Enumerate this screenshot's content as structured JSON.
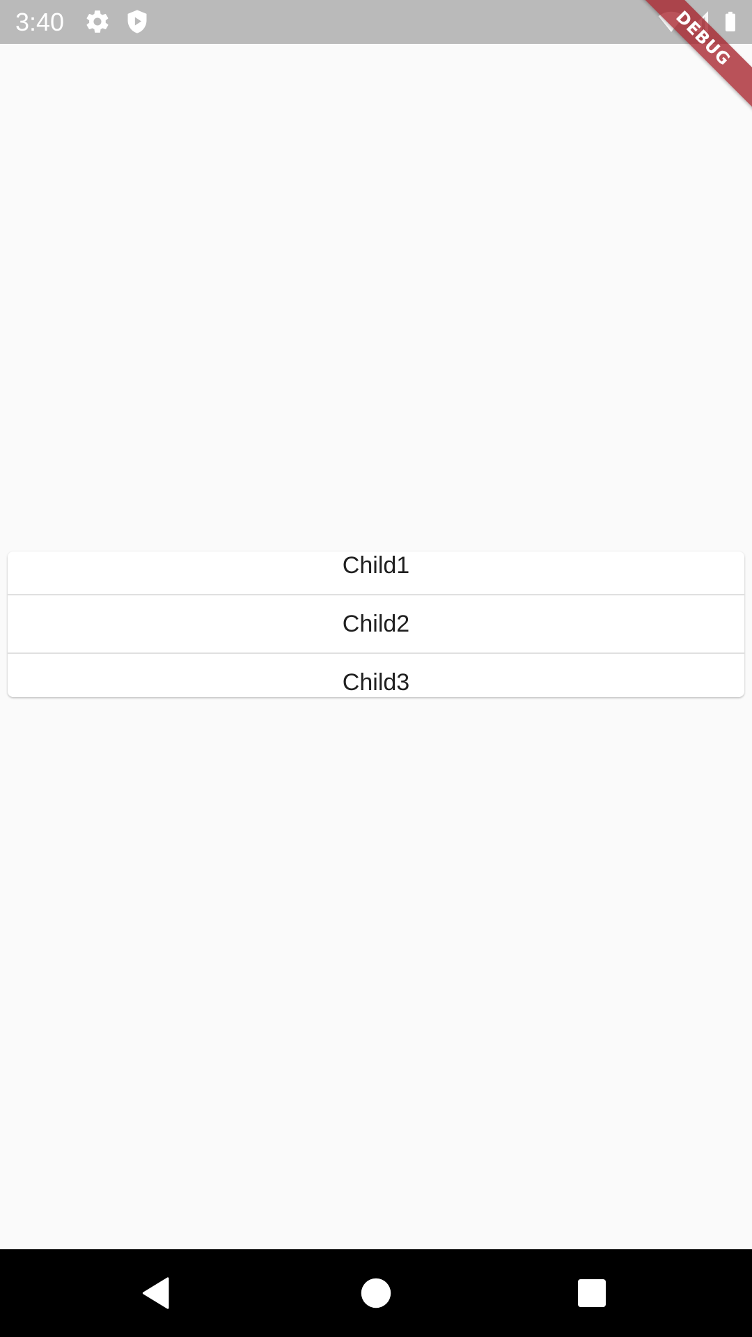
{
  "status_bar": {
    "time": "3:40",
    "icons": [
      "gear-icon",
      "shield-play-icon",
      "wifi-icon",
      "cell-signal-icon",
      "battery-icon"
    ]
  },
  "debug_banner": {
    "label": "DEBUG",
    "color": "#a6232b"
  },
  "list": {
    "items": [
      {
        "label": "Child1"
      },
      {
        "label": "Child2"
      },
      {
        "label": "Child3"
      }
    ]
  },
  "nav_bar": {
    "buttons": [
      "back-icon",
      "home-icon",
      "recents-icon"
    ]
  },
  "colors": {
    "background": "#fafafa",
    "status_bar": "#bababa",
    "nav_bar": "#000000",
    "card": "#ffffff"
  }
}
